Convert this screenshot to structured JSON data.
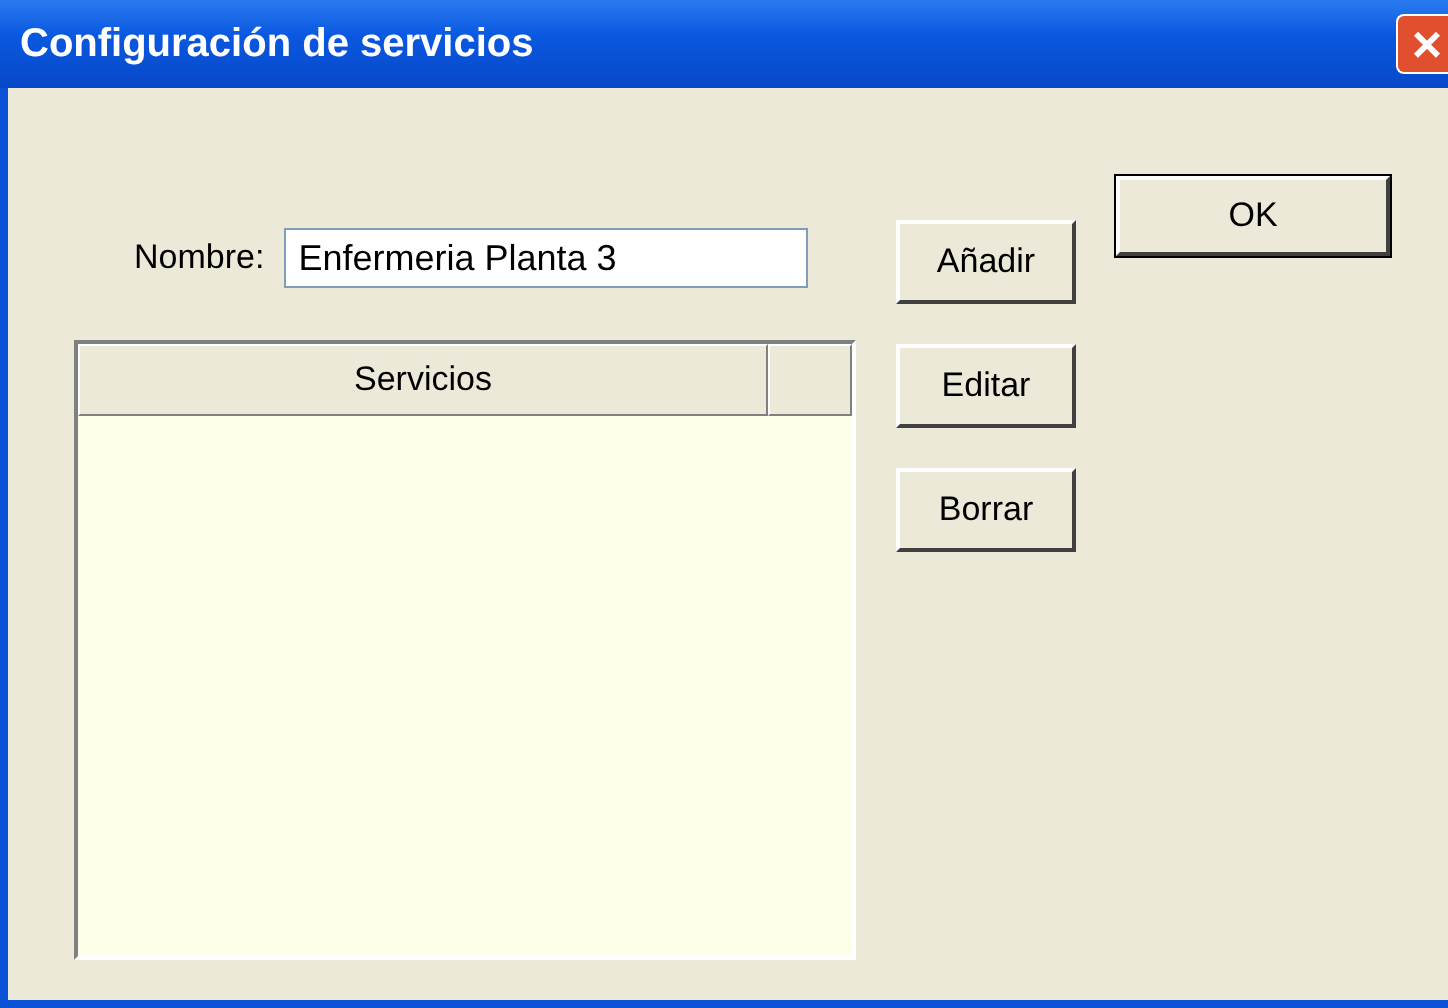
{
  "window": {
    "title": "Configuración de servicios",
    "close": "×"
  },
  "name_field": {
    "label": "Nombre:",
    "value": "Enfermeria Planta 3"
  },
  "list": {
    "columns": [
      "Servicios"
    ]
  },
  "buttons": [
    "Añadir",
    "Editar",
    "Borrar"
  ],
  "ok_button": "OK"
}
